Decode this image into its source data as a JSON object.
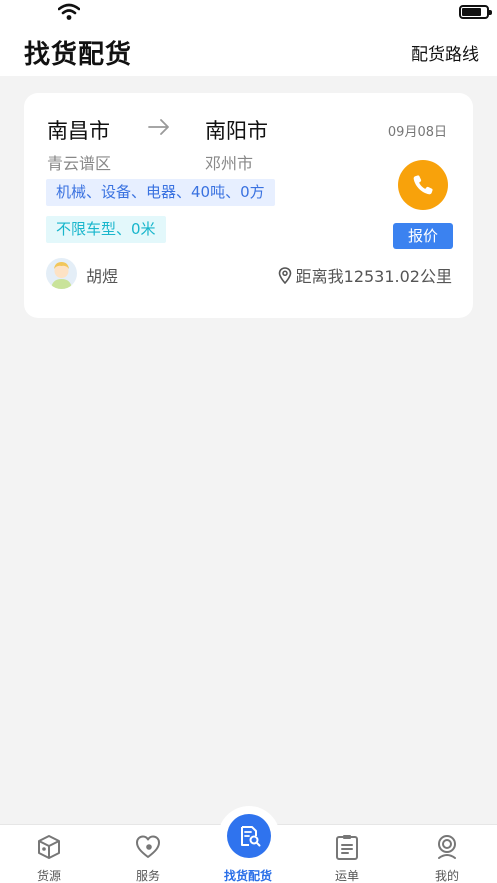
{
  "status_bar": {
    "wifi_icon": "wifi-icon",
    "battery_icon": "battery-icon"
  },
  "navbar": {
    "title": "找货配货",
    "action": "配货路线"
  },
  "cards": [
    {
      "from_city": "南昌市",
      "from_district": "青云谱区",
      "to_city": "南阳市",
      "to_district": "邓州市",
      "date": "09月08日",
      "cargo_tag": "机械、设备、电器、40吨、0方",
      "vehicle_tag": "不限车型、0米",
      "quote_label": "报价",
      "user_name": "胡煜",
      "distance": "距离我12531.02公里"
    }
  ],
  "tabbar": {
    "items": [
      {
        "label": "货源",
        "icon": "cube-icon"
      },
      {
        "label": "服务",
        "icon": "heart-service-icon"
      },
      {
        "label": "找货配货",
        "icon": "document-search-icon",
        "active": true
      },
      {
        "label": "运单",
        "icon": "clipboard-icon"
      },
      {
        "label": "我的",
        "icon": "user-icon"
      }
    ]
  },
  "colors": {
    "accent": "#2f73ee",
    "phone": "#f8a20b",
    "tag_blue_bg": "#e7efff",
    "tag_cyan_bg": "#e3f8fb"
  }
}
